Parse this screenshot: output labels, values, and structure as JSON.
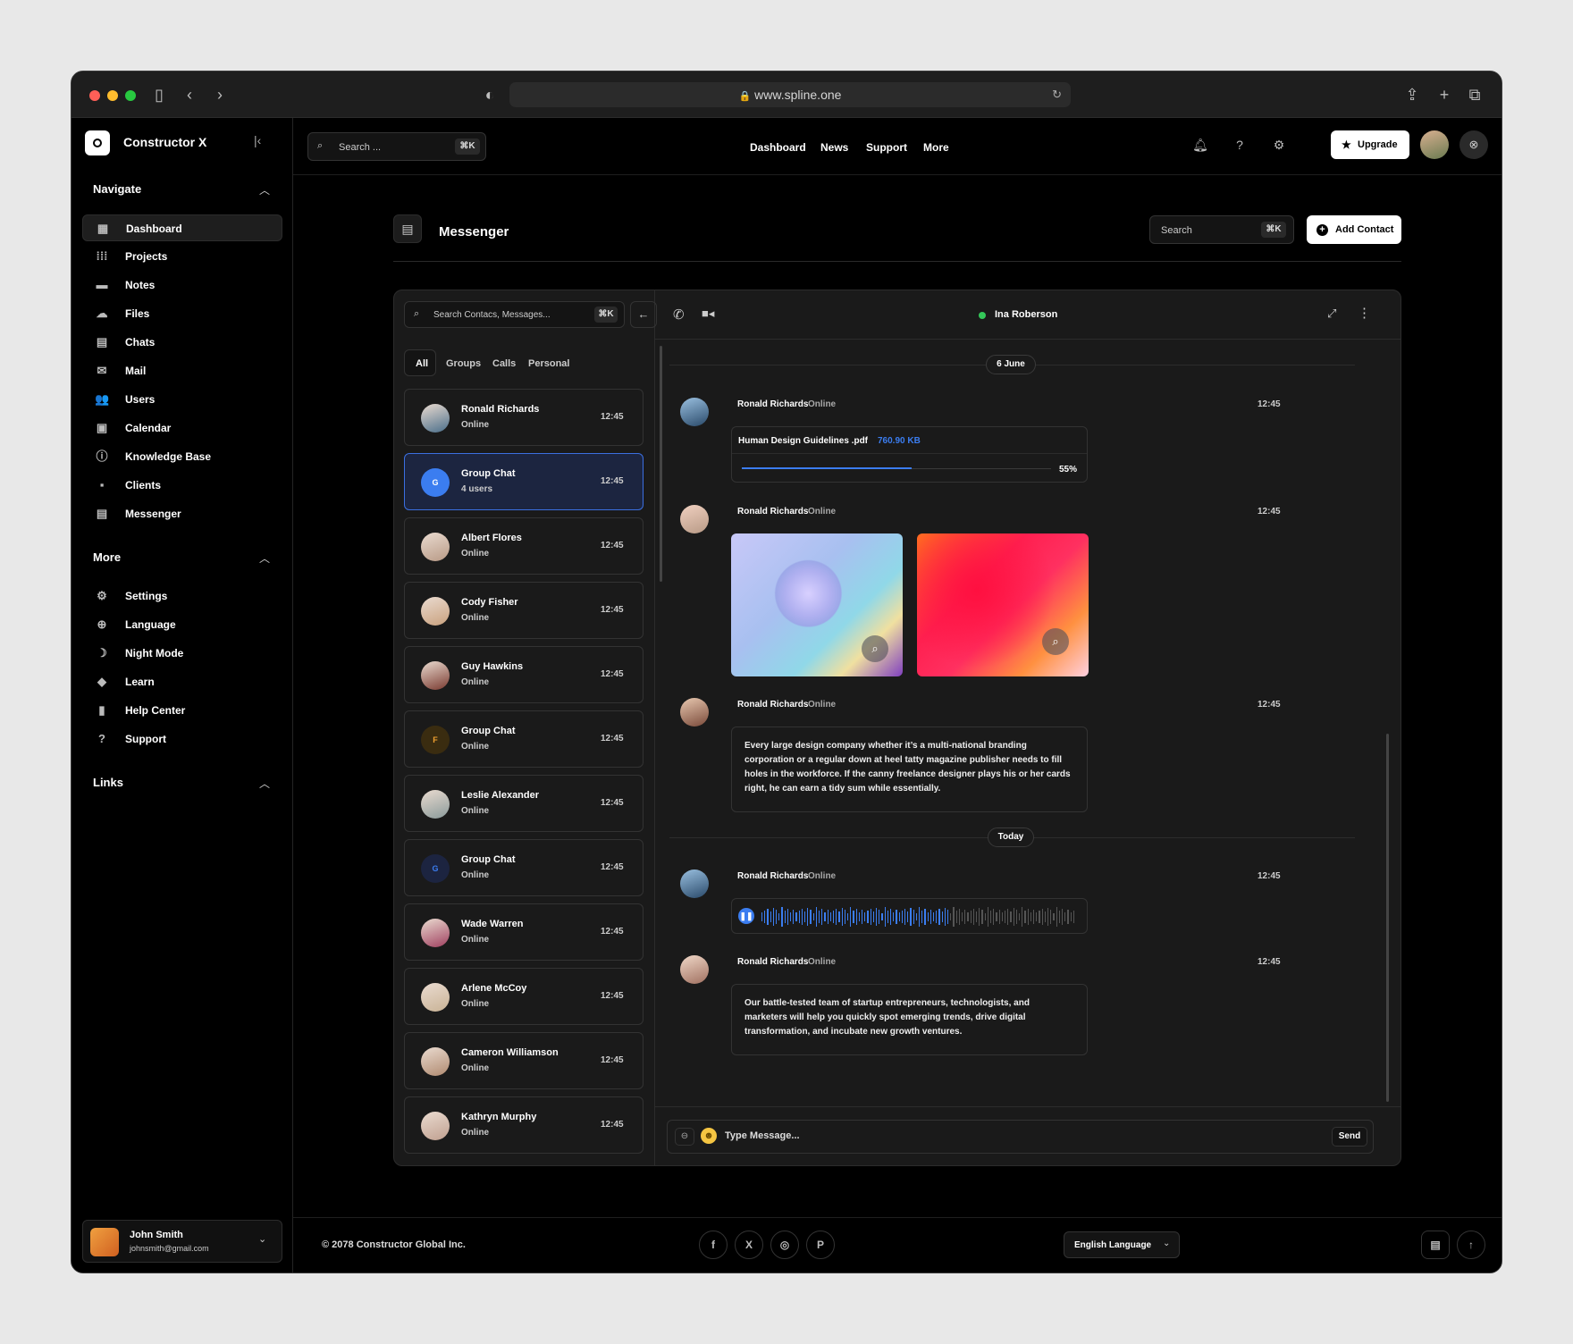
{
  "browser": {
    "url": "www.spline.one"
  },
  "sidebar": {
    "brand": "Constructor X",
    "navigate_title": "Navigate",
    "nav_items": [
      {
        "label": "Dashboard",
        "icon": "dashboard-icon",
        "glyph": "▦"
      },
      {
        "label": "Projects",
        "icon": "grid-icon",
        "glyph": "⁞⁞⁞"
      },
      {
        "label": "Notes",
        "icon": "note-icon",
        "glyph": "▬"
      },
      {
        "label": "Files",
        "icon": "cloud-icon",
        "glyph": "☁"
      },
      {
        "label": "Chats",
        "icon": "chat-icon",
        "glyph": "▤"
      },
      {
        "label": "Mail",
        "icon": "mail-icon",
        "glyph": "✉"
      },
      {
        "label": "Users",
        "icon": "users-icon",
        "glyph": "👥"
      },
      {
        "label": "Calendar",
        "icon": "calendar-icon",
        "glyph": "▣"
      },
      {
        "label": "Knowledge Base",
        "icon": "info-icon",
        "glyph": "ⓘ"
      },
      {
        "label": "Clients",
        "icon": "contact-card-icon",
        "glyph": "▪"
      },
      {
        "label": "Messenger",
        "icon": "messenger-icon",
        "glyph": "▤"
      }
    ],
    "more_title": "More",
    "more_items": [
      {
        "label": "Settings",
        "icon": "gear-icon",
        "glyph": "⚙"
      },
      {
        "label": "Language",
        "icon": "globe-icon",
        "glyph": "⊕"
      },
      {
        "label": "Night Mode",
        "icon": "moon-icon",
        "glyph": "☽"
      },
      {
        "label": "Learn",
        "icon": "graduation-cap-icon",
        "glyph": "◆"
      },
      {
        "label": "Help Center",
        "icon": "document-icon",
        "glyph": "▮"
      },
      {
        "label": "Support",
        "icon": "help-icon",
        "glyph": "?"
      }
    ],
    "links_title": "Links",
    "user": {
      "name": "John Smith",
      "email": "johnsmith@gmail.com"
    }
  },
  "topbar": {
    "search_placeholder": "Search ...",
    "search_kbd": "⌘K",
    "nav": [
      "Dashboard",
      "News",
      "Support",
      "More"
    ],
    "upgrade": "Upgrade"
  },
  "page": {
    "title": "Messenger",
    "search_placeholder": "Search",
    "search_kbd": "⌘K",
    "add_contact": "Add Contact"
  },
  "contacts": {
    "search_placeholder": "Search Contacs, Messages...",
    "search_kbd": "⌘K",
    "tabs": [
      "All",
      "Groups",
      "Calls",
      "Personal"
    ],
    "active_tab": "All",
    "items": [
      {
        "name": "Ronald Richards",
        "status": "Online",
        "time": "12:45",
        "avatar": "photo",
        "color": "#4a6e8a"
      },
      {
        "name": "Group Chat",
        "status": "4 users",
        "time": "12:45",
        "avatar": "G",
        "color": "#3b7df0",
        "selected": true
      },
      {
        "name": "Albert Flores",
        "status": "Online",
        "time": "12:45",
        "avatar": "photo",
        "color": "#b89a86"
      },
      {
        "name": "Cody Fisher",
        "status": "Online",
        "time": "12:45",
        "avatar": "photo",
        "color": "#c9a17e"
      },
      {
        "name": "Guy Hawkins",
        "status": "Online",
        "time": "12:45",
        "avatar": "photo",
        "color": "#7a3a30"
      },
      {
        "name": "Group Chat",
        "status": "Online",
        "time": "12:45",
        "avatar": "F",
        "color": "#3a2c10"
      },
      {
        "name": "Leslie Alexander",
        "status": "Online",
        "time": "12:45",
        "avatar": "photo",
        "color": "#8a9a9a"
      },
      {
        "name": "Group Chat",
        "status": "Online",
        "time": "12:45",
        "avatar": "G",
        "color": "#1c2440"
      },
      {
        "name": "Wade Warren",
        "status": "Online",
        "time": "12:45",
        "avatar": "photo",
        "color": "#a04060"
      },
      {
        "name": "Arlene McCoy",
        "status": "Online",
        "time": "12:45",
        "avatar": "photo",
        "color": "#c9b396"
      },
      {
        "name": "Cameron Williamson",
        "status": "Online",
        "time": "12:45",
        "avatar": "photo",
        "color": "#b08a70"
      },
      {
        "name": "Kathryn Murphy",
        "status": "Online",
        "time": "12:45",
        "avatar": "photo",
        "color": "#c0a090"
      }
    ]
  },
  "chat": {
    "contact_name": "Ina Roberson",
    "date1": "6 June",
    "date2": "Today",
    "messages": [
      {
        "name": "Ronald Richards",
        "status": "Online",
        "time": "12:45",
        "file": "Human Design Guidelines .pdf",
        "size": "760.90 KB",
        "progress_label": "55%",
        "progress": 0.55
      },
      {
        "name": "Ronald Richards",
        "status": "Online",
        "time": "12:45"
      },
      {
        "name": "Ronald Richards",
        "status": "Online",
        "time": "12:45",
        "text": "Every large design company whether it’s a multi-national branding corporation or a regular down at heel tatty magazine publisher needs to fill holes in the workforce. If the canny freelance designer plays his or her cards right, he can earn a tidy sum while essentially."
      },
      {
        "name": "Ronald Richards",
        "status": "Online",
        "time": "12:45"
      },
      {
        "name": "Ronald Richards",
        "status": "Online",
        "time": "12:45",
        "text": "Our battle-tested team of startup entrepreneurs, technologists, and marketers will help you quickly spot emerging trends, drive digital transformation, and incubate new growth ventures."
      }
    ],
    "input_placeholder": "Type Message...",
    "send": "Send"
  },
  "footer": {
    "copyright": "© 2078 Constructor Global Inc.",
    "language": "English Language"
  },
  "colors": {
    "accent": "#3b7df0",
    "online": "#34c759"
  }
}
